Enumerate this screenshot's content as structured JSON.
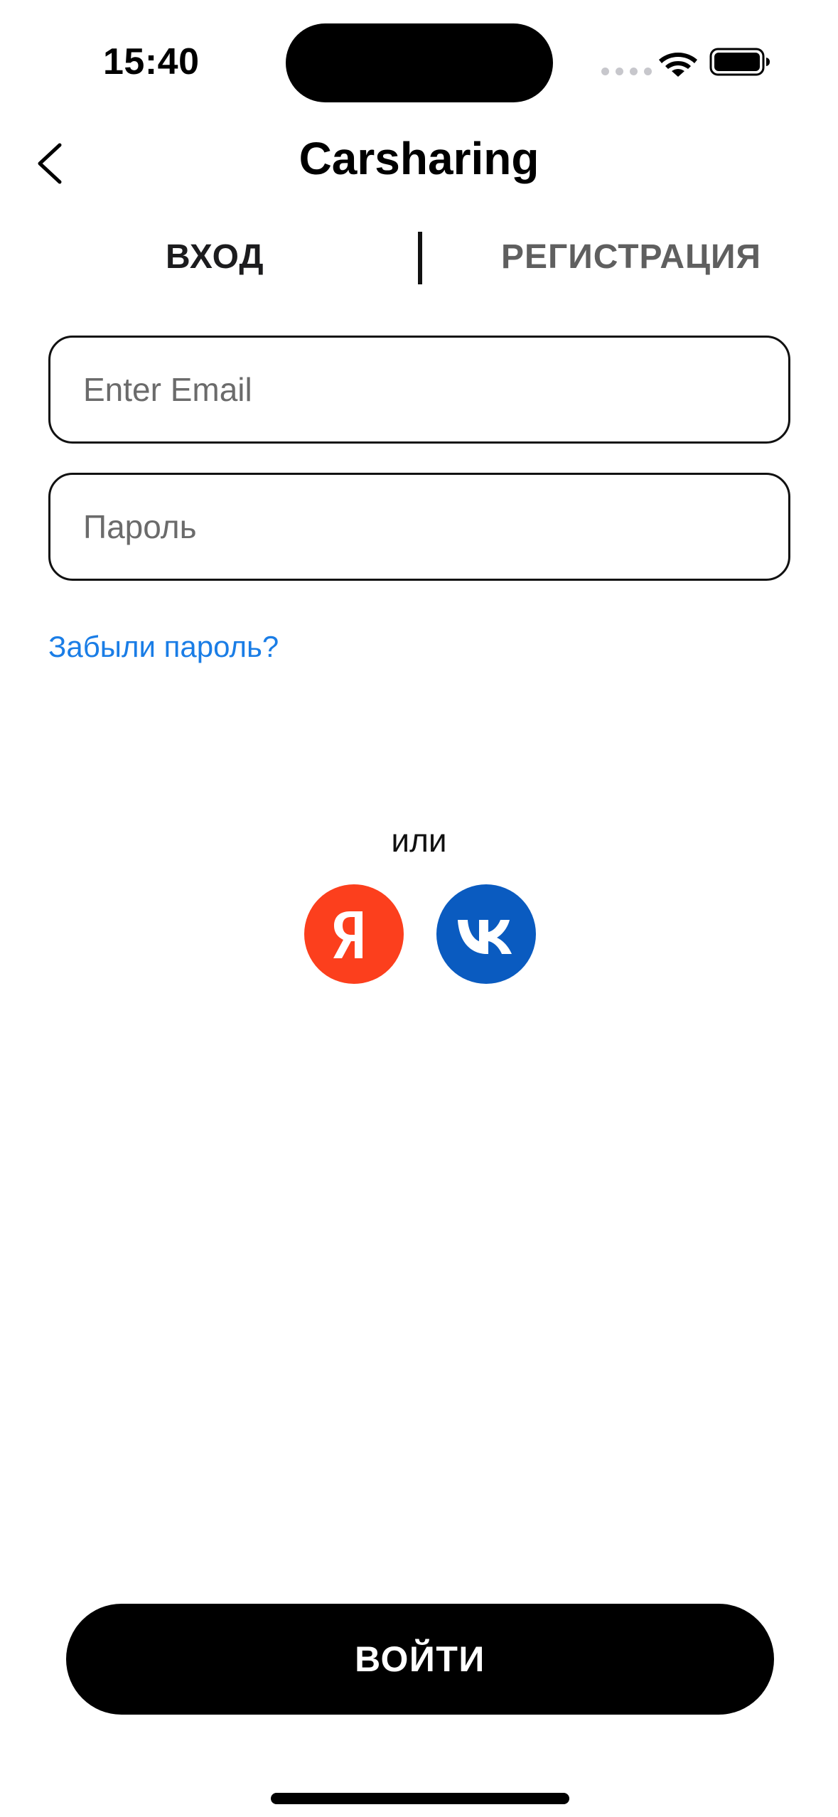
{
  "status_bar": {
    "time": "15:40",
    "icons": [
      "cellular-signal-icon",
      "wifi-icon",
      "battery-icon"
    ]
  },
  "nav": {
    "back_icon": "chevron-left-icon",
    "title": "Carsharing"
  },
  "tabs": [
    {
      "label": "ВХОД",
      "active": true
    },
    {
      "label": "РЕГИСТРАЦИЯ",
      "active": false
    }
  ],
  "form": {
    "email": {
      "value": "",
      "placeholder": "Enter Email"
    },
    "password": {
      "value": "",
      "placeholder": "Пароль"
    },
    "forgot_password": "Забыли пароль?"
  },
  "social": {
    "or_text": "или",
    "providers": [
      {
        "icon": "yandex-icon",
        "glyph": "Я",
        "color": "#fc3f1d"
      },
      {
        "icon": "vk-icon",
        "glyph": "VK",
        "color": "#0a5bc0"
      }
    ]
  },
  "primary_action": {
    "label": "ВОЙТИ"
  },
  "colors": {
    "link": "#1a7de6",
    "primary_button": "#000000",
    "inactive_tab": "#5f5f5f"
  }
}
